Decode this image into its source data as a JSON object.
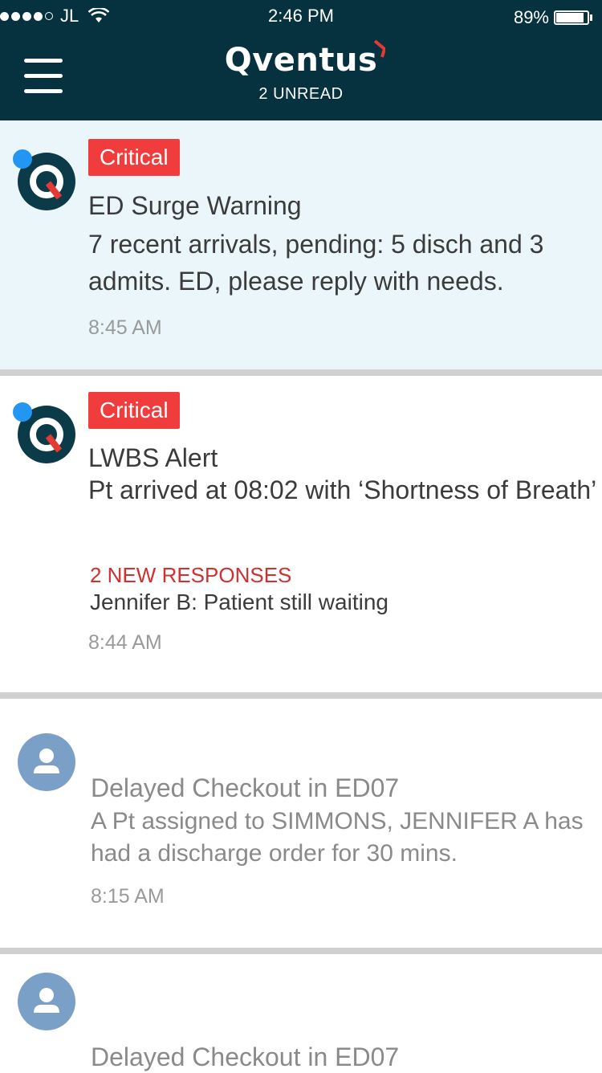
{
  "status_bar": {
    "carrier": "JL",
    "time": "2:46 PM",
    "battery": "89%",
    "battery_level": 0.89
  },
  "header": {
    "logo": "Qventus",
    "unread": "2 UNREAD",
    "menu_icon": "hamburger-menu-icon"
  },
  "colors": {
    "header_bg": "#06323f",
    "critical": "#f03c3c",
    "unread_dot": "#2196f3",
    "highlight_bg": "#eaf6fa",
    "responses": "#d32f2f"
  },
  "alerts": [
    {
      "badge": "Critical",
      "title": "ED Surge Warning",
      "body": "7 recent arrivals, pending: 5 disch and 3 admits. ED, please reply with needs.",
      "time": "8:45 AM"
    },
    {
      "badge": "Critical",
      "title": "LWBS Alert",
      "body": "Pt arrived at 08:02 with ‘Shortness of Breath’",
      "responses": "2 NEW RESPONSES",
      "reply": "Jennifer B: Patient still waiting",
      "time": "8:44 AM"
    },
    {
      "title": "Delayed Checkout in ED07",
      "body": "A Pt assigned to SIMMONS, JENNIFER A has had a discharge order for 30 mins.",
      "time": "8:15 AM"
    },
    {
      "title": "Delayed Checkout in ED07"
    }
  ]
}
